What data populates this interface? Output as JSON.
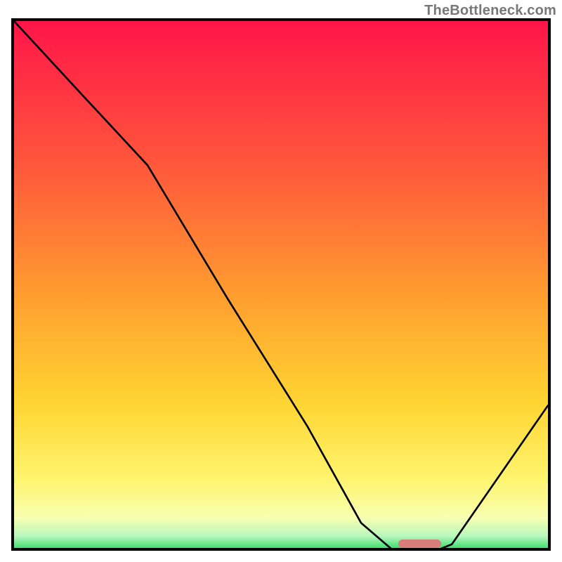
{
  "watermark": "TheBottleneck.com",
  "chart_data": {
    "type": "line",
    "title": "",
    "xlabel": "",
    "ylabel": "",
    "xlim": [
      0,
      100
    ],
    "ylim": [
      0,
      100
    ],
    "series": [
      {
        "name": "bottleneck-curve",
        "x": [
          0,
          12,
          25,
          40,
          55,
          65,
          72,
          77,
          82,
          100
        ],
        "values": [
          100,
          87,
          73,
          48,
          24,
          6,
          0,
          0,
          2,
          28
        ]
      }
    ],
    "marker": {
      "name": "optimal-range",
      "x_start": 72,
      "x_end": 80,
      "y": 0,
      "color": "#d97d7a"
    },
    "gradient_stops": [
      {
        "pos": 0.0,
        "color": "#ff1549"
      },
      {
        "pos": 0.28,
        "color": "#ff5a3b"
      },
      {
        "pos": 0.52,
        "color": "#ff9f2f"
      },
      {
        "pos": 0.72,
        "color": "#ffd633"
      },
      {
        "pos": 0.86,
        "color": "#fff570"
      },
      {
        "pos": 0.93,
        "color": "#f7ffb0"
      },
      {
        "pos": 0.965,
        "color": "#b8f7bd"
      },
      {
        "pos": 0.985,
        "color": "#4ae077"
      },
      {
        "pos": 1.0,
        "color": "#00c853"
      }
    ]
  }
}
